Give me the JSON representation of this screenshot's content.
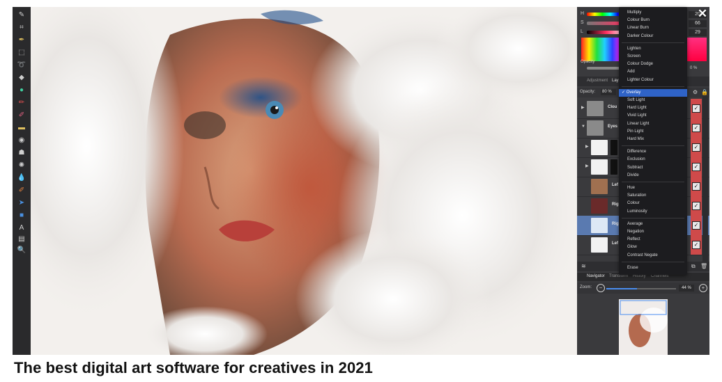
{
  "color_panel": {
    "labels": [
      "H",
      "S",
      "L"
    ],
    "values": [
      "20",
      "66",
      "29"
    ],
    "opacity_label": "Opacity",
    "opacity_value_right": "0 %"
  },
  "layers_panel": {
    "tabs": [
      "Adjustment",
      "Lay"
    ],
    "opacity_label": "Opacity:",
    "opacity_value": "80 %",
    "layers": [
      {
        "name": "Clou",
        "type": "folder",
        "expanded": false
      },
      {
        "name": "Eyes",
        "type": "folder",
        "expanded": true
      },
      {
        "name": "",
        "type": "image"
      },
      {
        "name": "",
        "type": "image"
      },
      {
        "name": "Lef",
        "type": "image"
      },
      {
        "name": "Rig",
        "type": "image"
      },
      {
        "name": "Rig",
        "type": "image",
        "selected": true
      },
      {
        "name": "Lef",
        "type": "image"
      }
    ]
  },
  "blend_dropdown": {
    "groups": [
      [
        "Multiply",
        "Colour Burn",
        "Linear Burn",
        "Darker Colour"
      ],
      [
        "Lighten",
        "Screen",
        "Colour Dodge",
        "Add",
        "Lighter Colour"
      ],
      [
        "Overlay",
        "Soft Light",
        "Hard Light",
        "Vivid Light",
        "Linear Light",
        "Pin Light",
        "Hard Mix"
      ],
      [
        "Difference",
        "Exclusion",
        "Subtract",
        "Divide"
      ],
      [
        "Hue",
        "Saturation",
        "Colour",
        "Luminosity"
      ],
      [
        "Average",
        "Negation",
        "Reflect",
        "Glow",
        "Contrast Negate"
      ],
      [
        "Erase"
      ]
    ],
    "selected": "Overlay"
  },
  "navigator": {
    "tabs": [
      "Navigator",
      "Transform",
      "History",
      "Channels"
    ],
    "zoom_label": "Zoom:",
    "zoom_value": "44 %",
    "zoom_level": 0.44
  },
  "caption": "The best digital art software for creatives in 2021",
  "icons": [
    "brush-icon",
    "crop-icon",
    "pen-icon",
    "selection-icon",
    "lasso-icon",
    "fill-icon",
    "color-picker-icon",
    "paint-brush-icon",
    "eraser-icon",
    "dodge-icon",
    "clone-icon",
    "smudge-icon",
    "blur-icon",
    "sharpen-icon",
    "move-icon",
    "rectangle-icon",
    "text-icon",
    "view-icon",
    "zoom-icon",
    "close-icon"
  ],
  "colors": {
    "accent": "#2f63c7",
    "visibility": "#cf4a4a",
    "panel_bg": "#3a3a3d"
  }
}
